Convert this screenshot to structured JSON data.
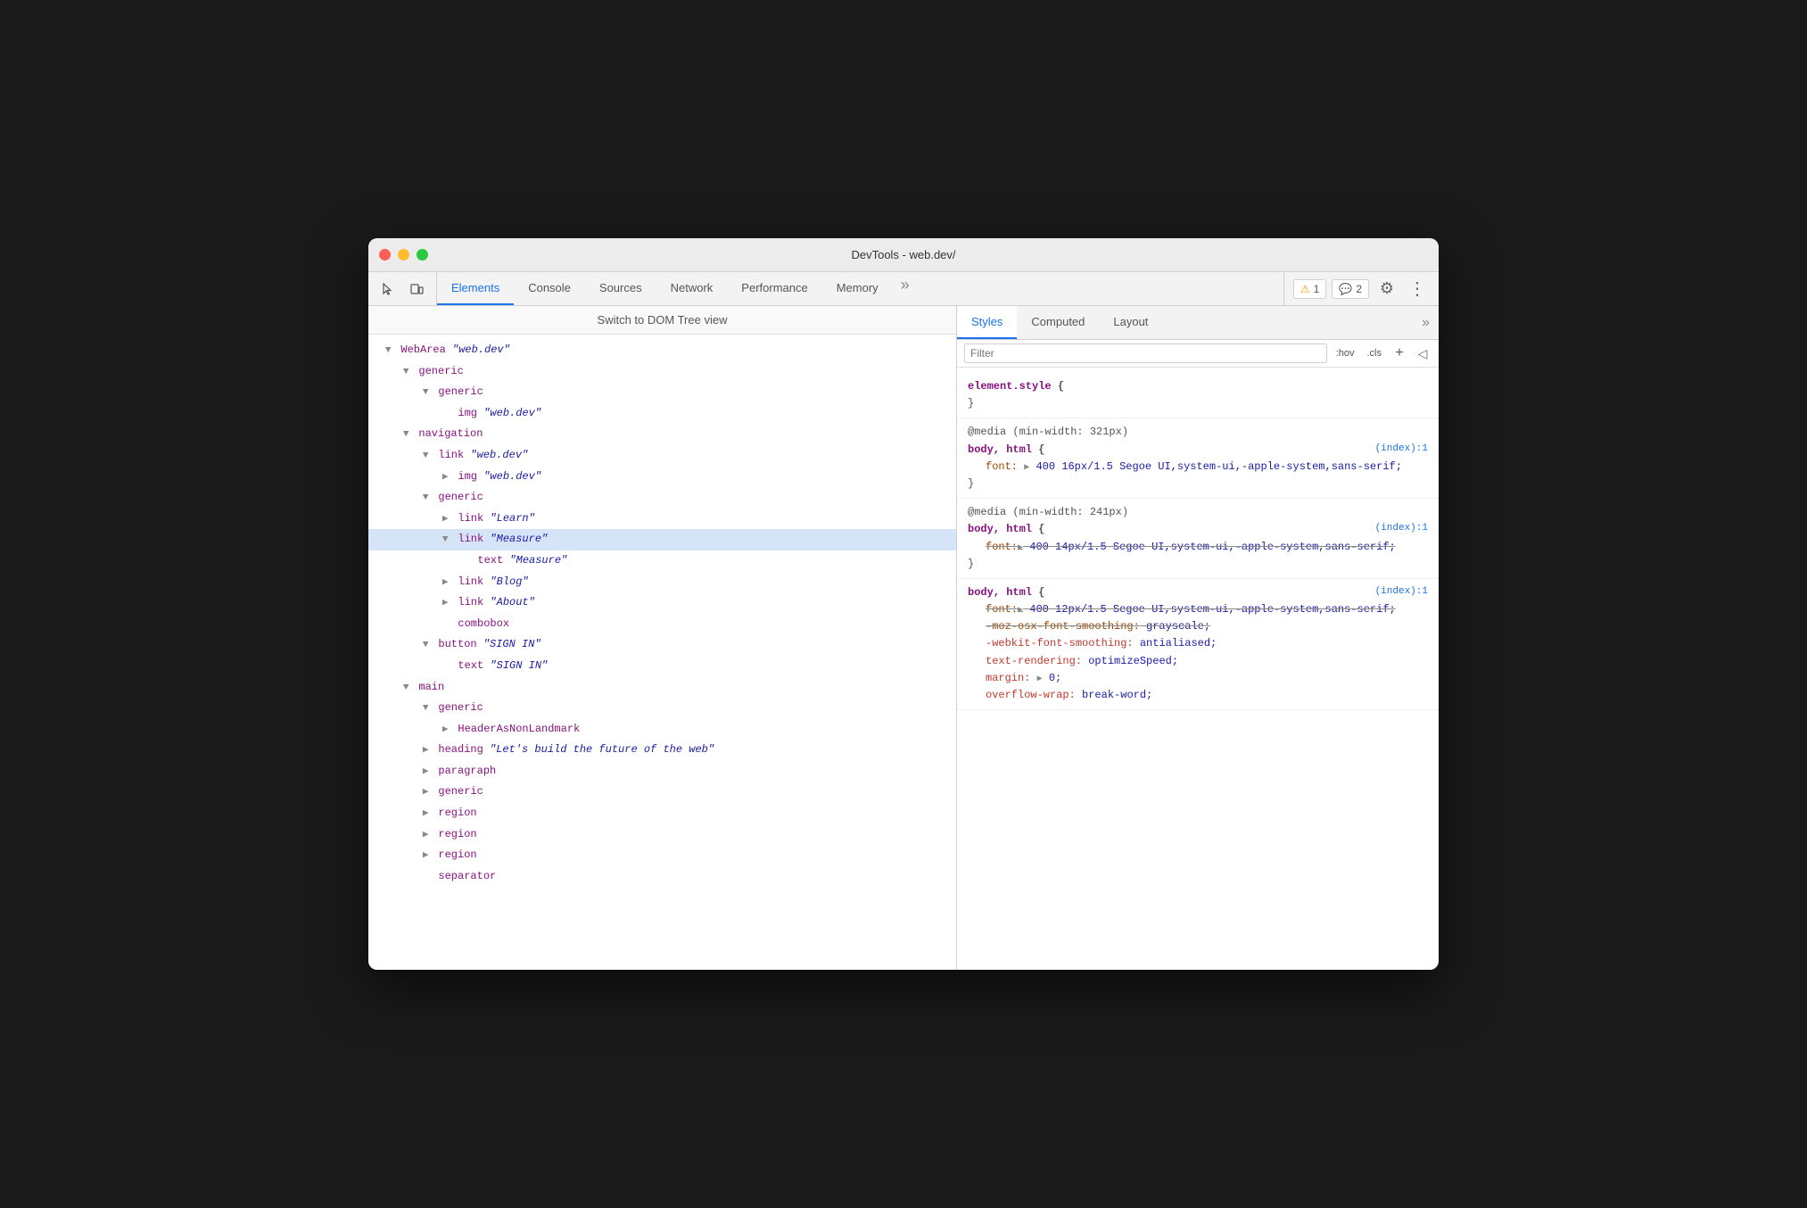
{
  "titlebar": {
    "title": "DevTools - web.dev/"
  },
  "toolbar": {
    "tabs": [
      {
        "id": "elements",
        "label": "Elements",
        "active": true
      },
      {
        "id": "console",
        "label": "Console",
        "active": false
      },
      {
        "id": "sources",
        "label": "Sources",
        "active": false
      },
      {
        "id": "network",
        "label": "Network",
        "active": false
      },
      {
        "id": "performance",
        "label": "Performance",
        "active": false
      },
      {
        "id": "memory",
        "label": "Memory",
        "active": false
      }
    ],
    "more_icon": "⋯",
    "warning_count": "1",
    "info_count": "2",
    "gear_icon": "⚙",
    "dots_icon": "⋮"
  },
  "dom_panel": {
    "header": "Switch to DOM Tree view",
    "tree": []
  },
  "styles_panel": {
    "tabs": [
      {
        "id": "styles",
        "label": "Styles",
        "active": true
      },
      {
        "id": "computed",
        "label": "Computed",
        "active": false
      },
      {
        "id": "layout",
        "label": "Layout",
        "active": false
      }
    ],
    "filter_placeholder": "Filter",
    "filter_hov": ":hov",
    "filter_cls": ".cls",
    "rules": []
  }
}
